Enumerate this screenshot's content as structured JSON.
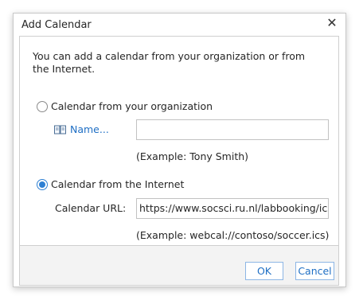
{
  "dialog": {
    "title": "Add Calendar",
    "close_icon": "close-icon"
  },
  "intro": "You can add a calendar from your organization or from the Internet.",
  "option_org": {
    "label": "Calendar from your organization",
    "checked": false
  },
  "name_link": {
    "label": "Name...",
    "icon": "address-book-icon"
  },
  "name_input": {
    "value": ""
  },
  "name_hint": "(Example: Tony Smith)",
  "option_internet": {
    "label": "Calendar from the Internet",
    "checked": true
  },
  "url_field": {
    "label": "Calendar URL:",
    "value": "https://www.socsci.ru.nl/labbooking/ics/"
  },
  "url_hint": "(Example: webcal://contoso/soccer.ics)",
  "buttons": {
    "ok": "OK",
    "cancel": "Cancel"
  },
  "colors": {
    "accent": "#2d7fd3",
    "link": "#1f6fc4",
    "button_border": "#8db6e5",
    "footer_bg": "#f3f3f3"
  }
}
